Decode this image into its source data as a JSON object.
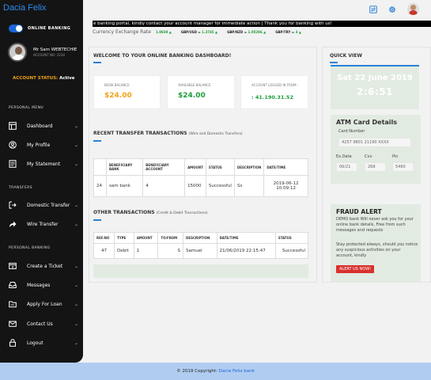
{
  "sidebar": {
    "brand": "Dacia Felix",
    "online_banking": "ONLINE BANKING",
    "user_name": "Mr Sam WEBTECHIE",
    "account_no": "ACCOUNT NO: 1234",
    "account_status_label": "ACCOUNT STATUS:",
    "account_status_value": "Active",
    "sections": {
      "personal_menu": "PERSONAL MENU",
      "transfers": "TRANSFERS",
      "personal_banking": "PERSONAL BANKING"
    },
    "items": [
      {
        "label": "Dashboard",
        "icon": "dashboard-icon"
      },
      {
        "label": "My Profile",
        "icon": "user-circle-icon"
      },
      {
        "label": "My Statement",
        "icon": "statement-icon"
      },
      {
        "label": "Domestic Transfer",
        "icon": "transfer-icon"
      },
      {
        "label": "Wire Transfer",
        "icon": "share-arrow-icon"
      },
      {
        "label": "Create a Ticket",
        "icon": "ticket-icon"
      },
      {
        "label": "Messages",
        "icon": "inbox-icon"
      },
      {
        "label": "Apply For Loan",
        "icon": "folder-icon"
      },
      {
        "label": "Contact Us",
        "icon": "envelope-icon"
      },
      {
        "label": "Logout",
        "icon": "lock-icon"
      }
    ],
    "chevron": "⌄"
  },
  "header": {
    "icons": [
      "transfer-icon",
      "gear-icon",
      "avatar"
    ],
    "marquee": "e banking portal, kindly contact your account manager for immediate action | Thank you for banking with us!",
    "rates_title": "Currency Exchange Rate",
    "rates": [
      {
        "pair": "",
        "value": "1.0839 ▲"
      },
      {
        "pair": "GBP/USD =",
        "value": "1.3745 ▲"
      },
      {
        "pair": "GBP/NZD =",
        "value": "1.95296 ▲"
      },
      {
        "pair": "GBP/TRY =",
        "value": "3 ▲"
      }
    ]
  },
  "main": {
    "welcome_title": "WELCOME TO YOUR ONLINE BANKING DASHBOARD!",
    "stats": [
      {
        "label": "BOOK BALANCE",
        "value": "$24.00",
        "color": "#f1a21a"
      },
      {
        "label": "AVAILABLE BALANCE",
        "value": "$24.00",
        "color": "#1f9d3a"
      },
      {
        "label": "ACCOUNT LOGGED IN FROM:",
        "value": ": 41.190.31.52",
        "color": "#1f9d3a"
      }
    ],
    "recent_title": "RECENT TRANSFER TRANSACTIONS",
    "recent_subtitle": "(Wire and Domestic Transfers)",
    "recent_headers": [
      "",
      "BENEFICIARY BANK",
      "BENEFICIARY ACCOUNT",
      "AMOUNT",
      "STATUS",
      "DESCRIPTION",
      "DATE/TIME"
    ],
    "recent_row": [
      "24",
      "sam bank",
      "4",
      "15000",
      "Successful",
      "Ss",
      "2019-06-12 10:09:12"
    ],
    "other_title": "OTHER TRANSACTIONS",
    "other_subtitle": "(Credit & Debit Transactions)",
    "other_headers": [
      "REF.NO",
      "TYPE",
      "AMOUNT",
      "TO/FROM",
      "DESCRIPTION",
      "DATE/TIME",
      "STATUS"
    ],
    "other_row": [
      "47",
      "Debit",
      "1",
      "S",
      "Samuel",
      "21/06/2019 22:15:47",
      "Successful"
    ]
  },
  "quick_view": {
    "title": "QUICK VIEW",
    "date": "Sat 22 June 2019",
    "time": "2:6:51"
  },
  "atm": {
    "title": "ATM Card Details",
    "card_number_label": "Card Number",
    "card_number": "4257 9801 21190 XXXX",
    "ex_date_label": "Ex.Date",
    "cvv_label": "Cvv",
    "pin_label": "Pin",
    "ex_date": "06/21",
    "cvv": "268",
    "pin": "5460"
  },
  "fraud": {
    "title": "FRAUD ALERT",
    "p1": "DEMO bank Will never ask you for your online bank details, Free from such messages and requests",
    "p2": "Stay protected always, should you notice any suspicious activities on your account, kindly",
    "button": "ALERT US NOW!"
  },
  "footer": {
    "text": "© 2019 Copyright:",
    "link": "Dacia Felix bank"
  }
}
